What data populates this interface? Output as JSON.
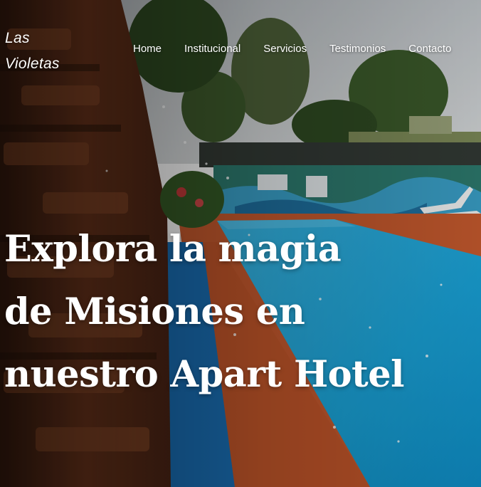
{
  "brand": {
    "line1": "Las",
    "line2": "Violetas"
  },
  "nav": {
    "items": [
      {
        "label": "Home"
      },
      {
        "label": "Institucional"
      },
      {
        "label": "Servicios"
      },
      {
        "label": "Testimonios"
      },
      {
        "label": "Contacto"
      }
    ]
  },
  "hero": {
    "headline_lines": [
      "Explora la magia",
      "de Misiones en",
      "nuestro Apart Hotel"
    ],
    "image_subject": "hotel pool with stone waterfall wall, lounge chairs and trees"
  },
  "colors": {
    "pool": "#1aa3d8",
    "pool_deck": "#c65a2e",
    "stone_wall": "#7a3e22",
    "sky": "#c9cdd0",
    "foliage": "#3b5a2a"
  }
}
